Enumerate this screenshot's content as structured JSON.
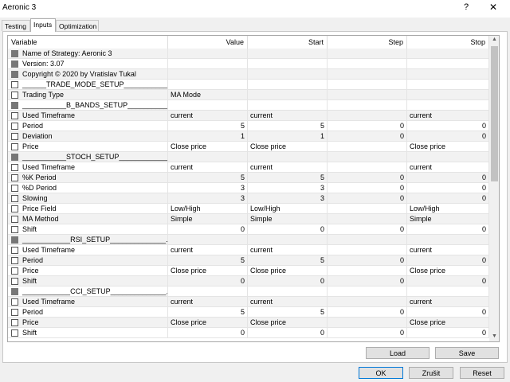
{
  "window": {
    "title": "Aeronic 3",
    "help_glyph": "?",
    "close_glyph": "✕"
  },
  "tabs": [
    {
      "label": "Testing",
      "active": false
    },
    {
      "label": "Inputs",
      "active": true
    },
    {
      "label": "Optimization",
      "active": false
    }
  ],
  "columns": [
    "Variable",
    "Value",
    "Start",
    "Step",
    "Stop"
  ],
  "rows": [
    {
      "cb": "gray",
      "var": "Name of Strategy: Aeronic 3",
      "value": "",
      "start": "",
      "step": "",
      "stop": ""
    },
    {
      "cb": "gray",
      "var": "Version: 3.07",
      "value": "",
      "start": "",
      "step": "",
      "stop": ""
    },
    {
      "cb": "gray",
      "var": "Copyright © 2020 by Vratislav Tukal",
      "value": "",
      "start": "",
      "step": "",
      "stop": ""
    },
    {
      "cb": "white",
      "var": "______TRADE_MODE_SETUP____________...",
      "value": "",
      "start": "",
      "step": "",
      "stop": ""
    },
    {
      "cb": "white",
      "var": "Trading Type",
      "value": "MA Mode",
      "start": "",
      "step": "",
      "stop": ""
    },
    {
      "cb": "gray",
      "var": "___________B_BANDS_SETUP____________...",
      "value": "",
      "start": "",
      "step": "",
      "stop": ""
    },
    {
      "cb": "white",
      "var": "Used Timeframe",
      "value": "current",
      "start": "current",
      "step": "",
      "stop": "current"
    },
    {
      "cb": "white",
      "var": "Period",
      "value": "5",
      "start": "5",
      "step": "0",
      "stop": "0",
      "numeric": true
    },
    {
      "cb": "white",
      "var": "Deviation",
      "value": "1",
      "start": "1",
      "step": "0",
      "stop": "0",
      "numeric": true
    },
    {
      "cb": "white",
      "var": "Price",
      "value": "Close price",
      "start": "Close price",
      "step": "",
      "stop": "Close price"
    },
    {
      "cb": "gray",
      "var": "___________STOCH_SETUP______________...",
      "value": "",
      "start": "",
      "step": "",
      "stop": ""
    },
    {
      "cb": "white",
      "var": "Used Timeframe",
      "value": "current",
      "start": "current",
      "step": "",
      "stop": "current"
    },
    {
      "cb": "white",
      "var": "%K Period",
      "value": "5",
      "start": "5",
      "step": "0",
      "stop": "0",
      "numeric": true
    },
    {
      "cb": "white",
      "var": "%D Period",
      "value": "3",
      "start": "3",
      "step": "0",
      "stop": "0",
      "numeric": true
    },
    {
      "cb": "white",
      "var": "Slowing",
      "value": "3",
      "start": "3",
      "step": "0",
      "stop": "0",
      "numeric": true
    },
    {
      "cb": "white",
      "var": "Price Field",
      "value": "Low/High",
      "start": "Low/High",
      "step": "",
      "stop": "Low/High"
    },
    {
      "cb": "white",
      "var": "MA Method",
      "value": "Simple",
      "start": "Simple",
      "step": "",
      "stop": "Simple"
    },
    {
      "cb": "white",
      "var": "Shift",
      "value": "0",
      "start": "0",
      "step": "0",
      "stop": "0",
      "numeric": true
    },
    {
      "cb": "gray",
      "var": "____________RSI_SETUP______________...",
      "value": "",
      "start": "",
      "step": "",
      "stop": ""
    },
    {
      "cb": "white",
      "var": "Used Timeframe",
      "value": "current",
      "start": "current",
      "step": "",
      "stop": "current"
    },
    {
      "cb": "white",
      "var": "Period",
      "value": "5",
      "start": "5",
      "step": "0",
      "stop": "0",
      "numeric": true
    },
    {
      "cb": "white",
      "var": "Price",
      "value": "Close price",
      "start": "Close price",
      "step": "",
      "stop": "Close price"
    },
    {
      "cb": "white",
      "var": "Shift",
      "value": "0",
      "start": "0",
      "step": "0",
      "stop": "0",
      "numeric": true
    },
    {
      "cb": "gray",
      "var": "____________CCI_SETUP______________...",
      "value": "",
      "start": "",
      "step": "",
      "stop": ""
    },
    {
      "cb": "white",
      "var": "Used Timeframe",
      "value": "current",
      "start": "current",
      "step": "",
      "stop": "current"
    },
    {
      "cb": "white",
      "var": "Period",
      "value": "5",
      "start": "5",
      "step": "0",
      "stop": "0",
      "numeric": true
    },
    {
      "cb": "white",
      "var": "Price",
      "value": "Close price",
      "start": "Close price",
      "step": "",
      "stop": "Close price"
    },
    {
      "cb": "white",
      "var": "Shift",
      "value": "0",
      "start": "0",
      "step": "0",
      "stop": "0",
      "numeric": true
    }
  ],
  "buttons": {
    "load": "Load",
    "save": "Save",
    "ok": "OK",
    "cancel": "Zrušit",
    "reset": "Reset"
  },
  "colors": {
    "accent": "#0078d7"
  }
}
